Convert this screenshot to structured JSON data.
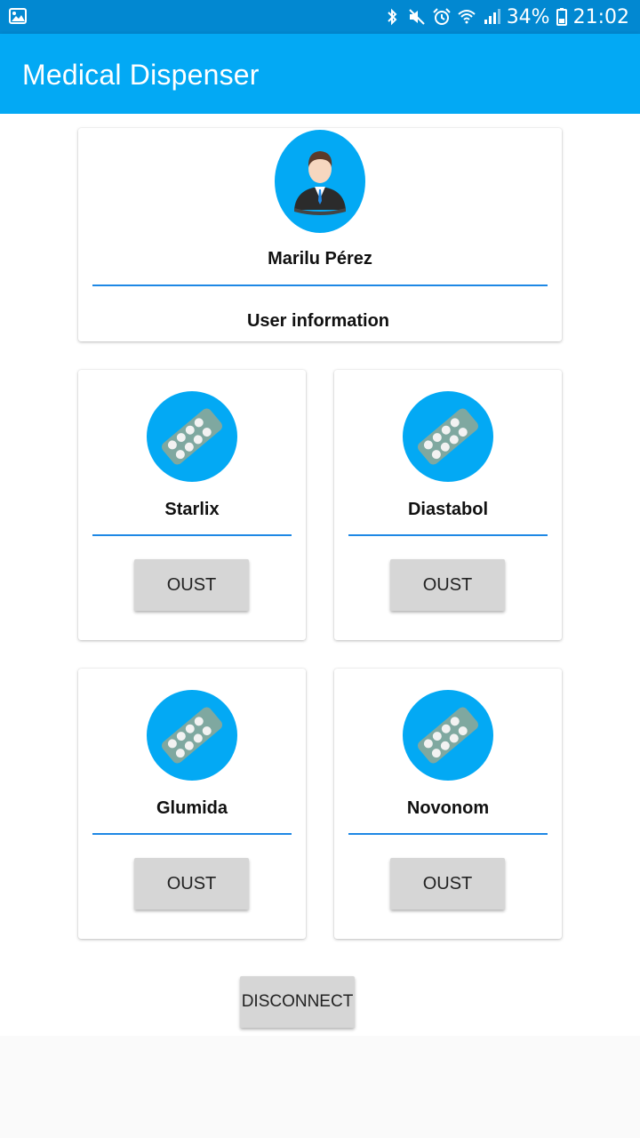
{
  "status_bar": {
    "battery": "34%",
    "time": "21:02",
    "icons": [
      "image-icon",
      "bluetooth-icon",
      "mute-icon",
      "alarm-icon",
      "wifi-icon",
      "signal-icon",
      "battery-icon"
    ]
  },
  "app_bar": {
    "title": "Medical Dispenser"
  },
  "user": {
    "name": "Marilu Pérez",
    "info_label": "User information",
    "avatar_icon": "user-avatar-icon"
  },
  "medicines": [
    {
      "name": "Starlix",
      "button": "OUST"
    },
    {
      "name": "Diastabol",
      "button": "OUST"
    },
    {
      "name": "Glumida",
      "button": "OUST"
    },
    {
      "name": "Novonom",
      "button": "OUST"
    }
  ],
  "disconnect_label": "DISCONNECT",
  "colors": {
    "status_bar": "#0288d1",
    "app_bar": "#03a9f4",
    "accent_circle": "#03a9f4",
    "divider": "#1e88e5",
    "button": "#d6d6d6"
  }
}
